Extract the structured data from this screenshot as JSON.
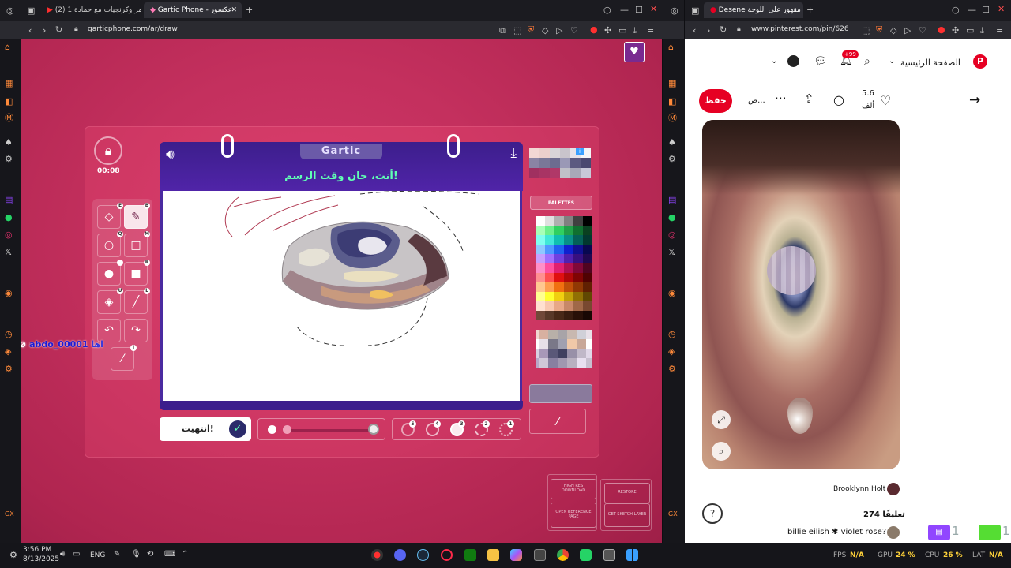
{
  "left_browser": {
    "tabs": [
      {
        "label": "(2) ميمز وكرنجيات مع حمادة 1",
        "active": false
      },
      {
        "label": "Gartic Phone - عكسور",
        "active": true
      }
    ],
    "url": "garticphone.com/ar/draw"
  },
  "right_browser": {
    "tabs": [
      {
        "label": "Desene مقهور على اللوحة",
        "active": true
      }
    ],
    "url": "www.pinterest.com/pin/626"
  },
  "gartic": {
    "logo": "Gartic",
    "timer": "00:08",
    "prompt": "أنت، حان وقت الرسم!",
    "done_label": "انتهيت!",
    "palettes_label": "PALETTES",
    "player_tag": "abdo_00001 اها",
    "tool_badges": [
      "E",
      "B",
      "Q",
      "M",
      "",
      "R",
      "U",
      "L",
      "I"
    ],
    "opacity_badges": [
      "5",
      "4",
      "3",
      "2",
      "1"
    ],
    "side_buttons": {
      "high_res": "HIGH RES DOWNLOAD",
      "open_ref": "OPEN REFERENCE PAGE",
      "restore": "RESTORE",
      "get_sketch": "GET SKETCH LAYER"
    },
    "colors": {
      "accent_green": "#60ffb4",
      "header_purple": "#4a2aa0",
      "bg_pink": "#c4305e"
    }
  },
  "pinterest": {
    "home": "الصفحة الرئيسية",
    "notif_count": "+99",
    "save": "حفظ",
    "likes": "5.6",
    "likes_unit": "ألف",
    "board_short": "ص...",
    "author": "Brooklynn Holt",
    "comments": "274 تعليقًا",
    "comment": "billie eilish ✱ violet rose?",
    "help": "?"
  },
  "taskbar": {
    "time": "3:56 PM",
    "date": "8/13/2025",
    "lang": "ENG",
    "fps_label": "FPS",
    "fps": "N/A",
    "gpu_label": "GPU",
    "gpu": "24 %",
    "cpu_label": "CPU",
    "cpu": "26 %",
    "lat_label": "LAT",
    "lat": "N/A",
    "overlay_count_1": "1",
    "overlay_count_2": "1"
  }
}
